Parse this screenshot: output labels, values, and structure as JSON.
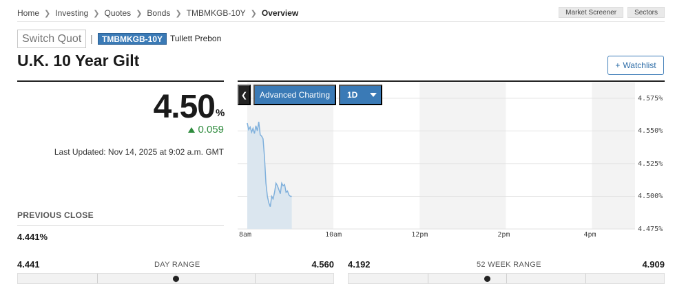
{
  "breadcrumb": {
    "items": [
      "Home",
      "Investing",
      "Quotes",
      "Bonds",
      "TMBMKGB-10Y"
    ],
    "current": "Overview"
  },
  "top_actions": [
    "Market Screener",
    "Sectors"
  ],
  "quote_bar": {
    "switch_quote_placeholder": "Switch Quotes",
    "ticker": "TMBMKGB-10Y",
    "source": "Tullett Prebon"
  },
  "title": "U.K. 10 Year Gilt",
  "watchlist_label": "Watchlist",
  "price": {
    "value": "4.50",
    "unit": "%",
    "change": "0.059",
    "direction": "up",
    "last_updated": "Last Updated: Nov 14, 2025 at 9:02 a.m. GMT"
  },
  "previous_close": {
    "label": "PREVIOUS CLOSE",
    "value": "4.441%"
  },
  "chart_controls": {
    "advanced_label": "Advanced Charting",
    "range_label": "1D"
  },
  "chart_data": {
    "type": "area",
    "x_ticks": [
      "8am",
      "10am",
      "12pm",
      "2pm",
      "4pm"
    ],
    "y_ticks": [
      "4.575%",
      "4.550%",
      "4.525%",
      "4.500%",
      "4.475%"
    ],
    "ylim": [
      4.475,
      4.587
    ],
    "grid": true,
    "line_color": "#7fb0dc",
    "fill_color": "#dbe6ef",
    "series": [
      {
        "x": [
          "8:00",
          "8:02",
          "8:04",
          "8:06",
          "8:08",
          "8:10",
          "8:12",
          "8:14",
          "8:16",
          "8:18",
          "8:20",
          "8:22",
          "8:24",
          "8:26",
          "8:28",
          "8:30",
          "8:32",
          "8:34",
          "8:36",
          "8:38",
          "8:40",
          "8:42",
          "8:44",
          "8:46",
          "8:48",
          "8:50",
          "8:52",
          "8:54",
          "8:56",
          "8:58",
          "9:00",
          "9:02"
        ],
        "values": [
          4.556,
          4.551,
          4.553,
          4.549,
          4.552,
          4.548,
          4.554,
          4.55,
          4.557,
          4.547,
          4.546,
          4.544,
          4.53,
          4.51,
          4.5,
          4.495,
          4.492,
          4.5,
          4.498,
          4.503,
          4.51,
          4.508,
          4.505,
          4.502,
          4.51,
          4.508,
          4.509,
          4.503,
          4.504,
          4.501,
          4.5,
          4.5
        ]
      }
    ]
  },
  "day_range": {
    "label": "DAY RANGE",
    "low": "4.441",
    "high": "4.560",
    "position": 0.5
  },
  "week52_range": {
    "label": "52 WEEK RANGE",
    "low": "4.192",
    "high": "4.909",
    "position": 0.44
  }
}
